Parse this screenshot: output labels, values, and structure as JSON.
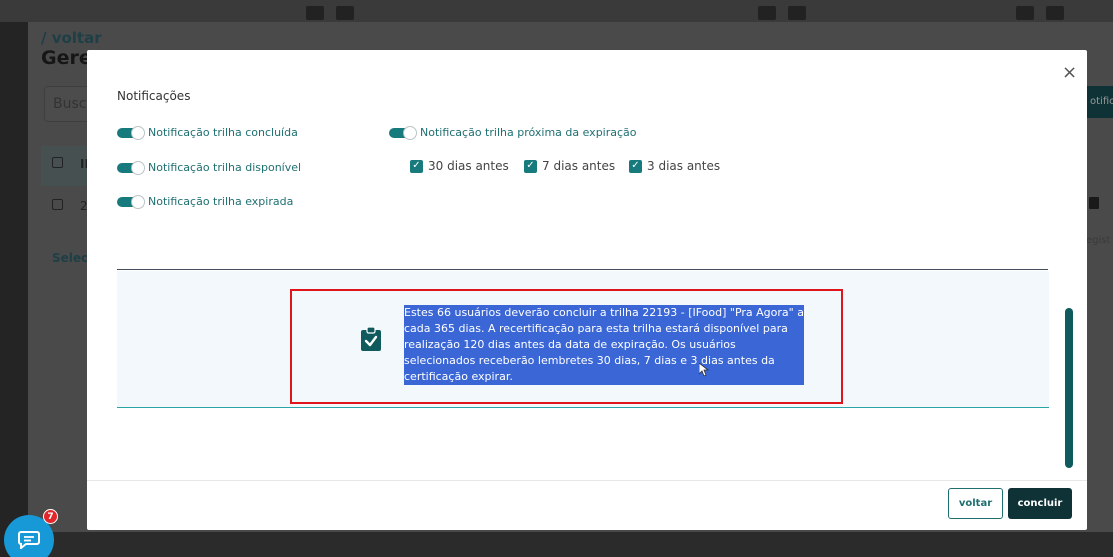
{
  "background": {
    "back_link": "/ voltar",
    "page_title": "Geren",
    "search_placeholder": "Busca",
    "header_id": "ID",
    "row_id": "2",
    "select_link": "Selecio",
    "right_button_label": "otifica",
    "right_text": "egist"
  },
  "modal": {
    "close_symbol": "×",
    "section_title": "Notificações",
    "toggles": {
      "trilha_concluida": "Notificação trilha concluída",
      "trilha_disponivel": "Notificação trilha disponível",
      "trilha_expirada": "Notificação trilha expirada",
      "proxima_expiracao": "Notificação trilha próxima da expiração"
    },
    "checkboxes": [
      {
        "label": "30 dias antes",
        "checked": true
      },
      {
        "label": "7 dias antes",
        "checked": true
      },
      {
        "label": "3 dias antes",
        "checked": true
      }
    ],
    "info_text": "Estes 66 usuários deverão concluir a trilha 22193 - [IFood] \"Pra Agora\" a cada 365 dias. A recertificação para esta trilha estará disponível para realização 120 dias antes da data de expiração. Os usuários selecionados receberão lembretes 30 dias, 7 dias e 3 dias antes da certificação expirar.",
    "buttons": {
      "back": "voltar",
      "finish": "concluir"
    }
  },
  "chat": {
    "badge_count": "7"
  },
  "colors": {
    "accent": "#177a7c",
    "dark_button": "#0e3236",
    "highlight": "#3a66d6",
    "annotation_border": "#e0141b",
    "chat": "#1799d8"
  },
  "icons": [
    "close-icon",
    "clipboard-check-icon",
    "cursor-icon",
    "chat-icon",
    "trash-icon"
  ]
}
